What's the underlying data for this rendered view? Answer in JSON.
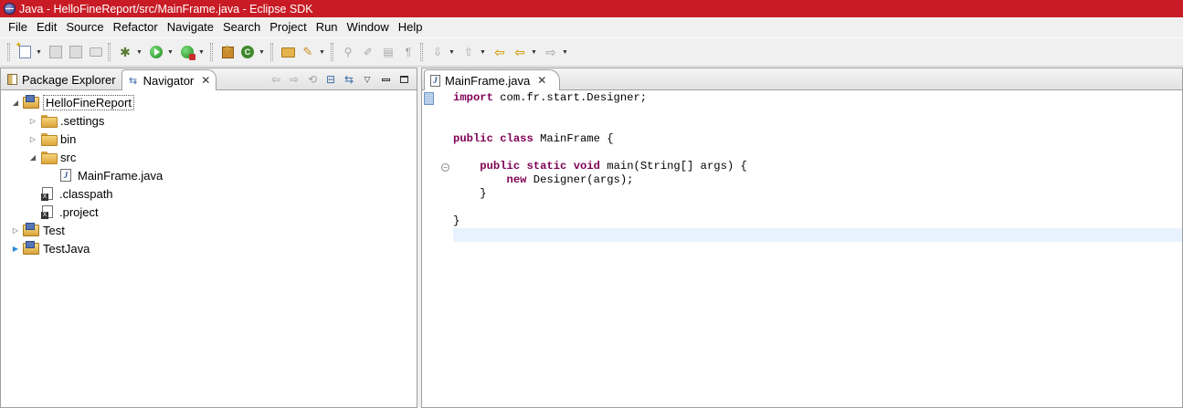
{
  "window": {
    "title": "Java - HelloFineReport/src/MainFrame.java - Eclipse SDK"
  },
  "menu": [
    "File",
    "Edit",
    "Source",
    "Refactor",
    "Navigate",
    "Search",
    "Project",
    "Run",
    "Window",
    "Help"
  ],
  "toolbar": {
    "icons": [
      "new-icon",
      "save-icon",
      "save-all-icon",
      "print-icon",
      "debug-icon",
      "run-icon",
      "external-tools-icon",
      "new-package-icon",
      "new-class-icon",
      "open-type-icon",
      "search-icon",
      "toggle-mark-icon",
      "pencil-icon",
      "show-whitespace-icon",
      "paragraph-icon",
      "next-annotation-icon",
      "prev-annotation-icon",
      "last-edit-icon",
      "back-icon",
      "forward-icon"
    ]
  },
  "left_view": {
    "tabs": [
      {
        "label": "Package Explorer",
        "active": false,
        "icon": "package-explorer-icon"
      },
      {
        "label": "Navigator",
        "active": true,
        "icon": "navigator-icon"
      }
    ],
    "tree": [
      {
        "label": "HelloFineReport",
        "depth": 0,
        "expanded": true,
        "type": "project",
        "selected": true
      },
      {
        "label": ".settings",
        "depth": 1,
        "expanded": false,
        "type": "folder"
      },
      {
        "label": "bin",
        "depth": 1,
        "expanded": false,
        "type": "folder"
      },
      {
        "label": "src",
        "depth": 1,
        "expanded": true,
        "type": "folder"
      },
      {
        "label": "MainFrame.java",
        "depth": 2,
        "type": "java"
      },
      {
        "label": ".classpath",
        "depth": 1,
        "type": "xml"
      },
      {
        "label": ".project",
        "depth": 1,
        "type": "xml"
      },
      {
        "label": "Test",
        "depth": 0,
        "expanded": false,
        "type": "project"
      },
      {
        "label": "TestJava",
        "depth": 0,
        "expanded": false,
        "type": "project"
      }
    ]
  },
  "editor": {
    "tab_label": "MainFrame.java",
    "lines": [
      [
        {
          "t": "import",
          "kw": true
        },
        {
          "t": " com.fr.start.Designer;"
        }
      ],
      [],
      [],
      [
        {
          "t": "public",
          "kw": true
        },
        {
          "t": " "
        },
        {
          "t": "class",
          "kw": true
        },
        {
          "t": " MainFrame {"
        }
      ],
      [],
      [
        {
          "t": "    "
        },
        {
          "t": "public",
          "kw": true
        },
        {
          "t": " "
        },
        {
          "t": "static",
          "kw": true
        },
        {
          "t": " "
        },
        {
          "t": "void",
          "kw": true
        },
        {
          "t": " main(String[] args) {"
        }
      ],
      [
        {
          "t": "        "
        },
        {
          "t": "new",
          "kw": true
        },
        {
          "t": " Designer(args);"
        }
      ],
      [
        {
          "t": "    }"
        }
      ],
      [],
      [
        {
          "t": "}"
        }
      ],
      []
    ],
    "current_line": 10,
    "fold_line": 5
  },
  "colors": {
    "titlebar": "#c81b25",
    "keyword": "#7f0055",
    "current_line": "#e8f2fe"
  }
}
